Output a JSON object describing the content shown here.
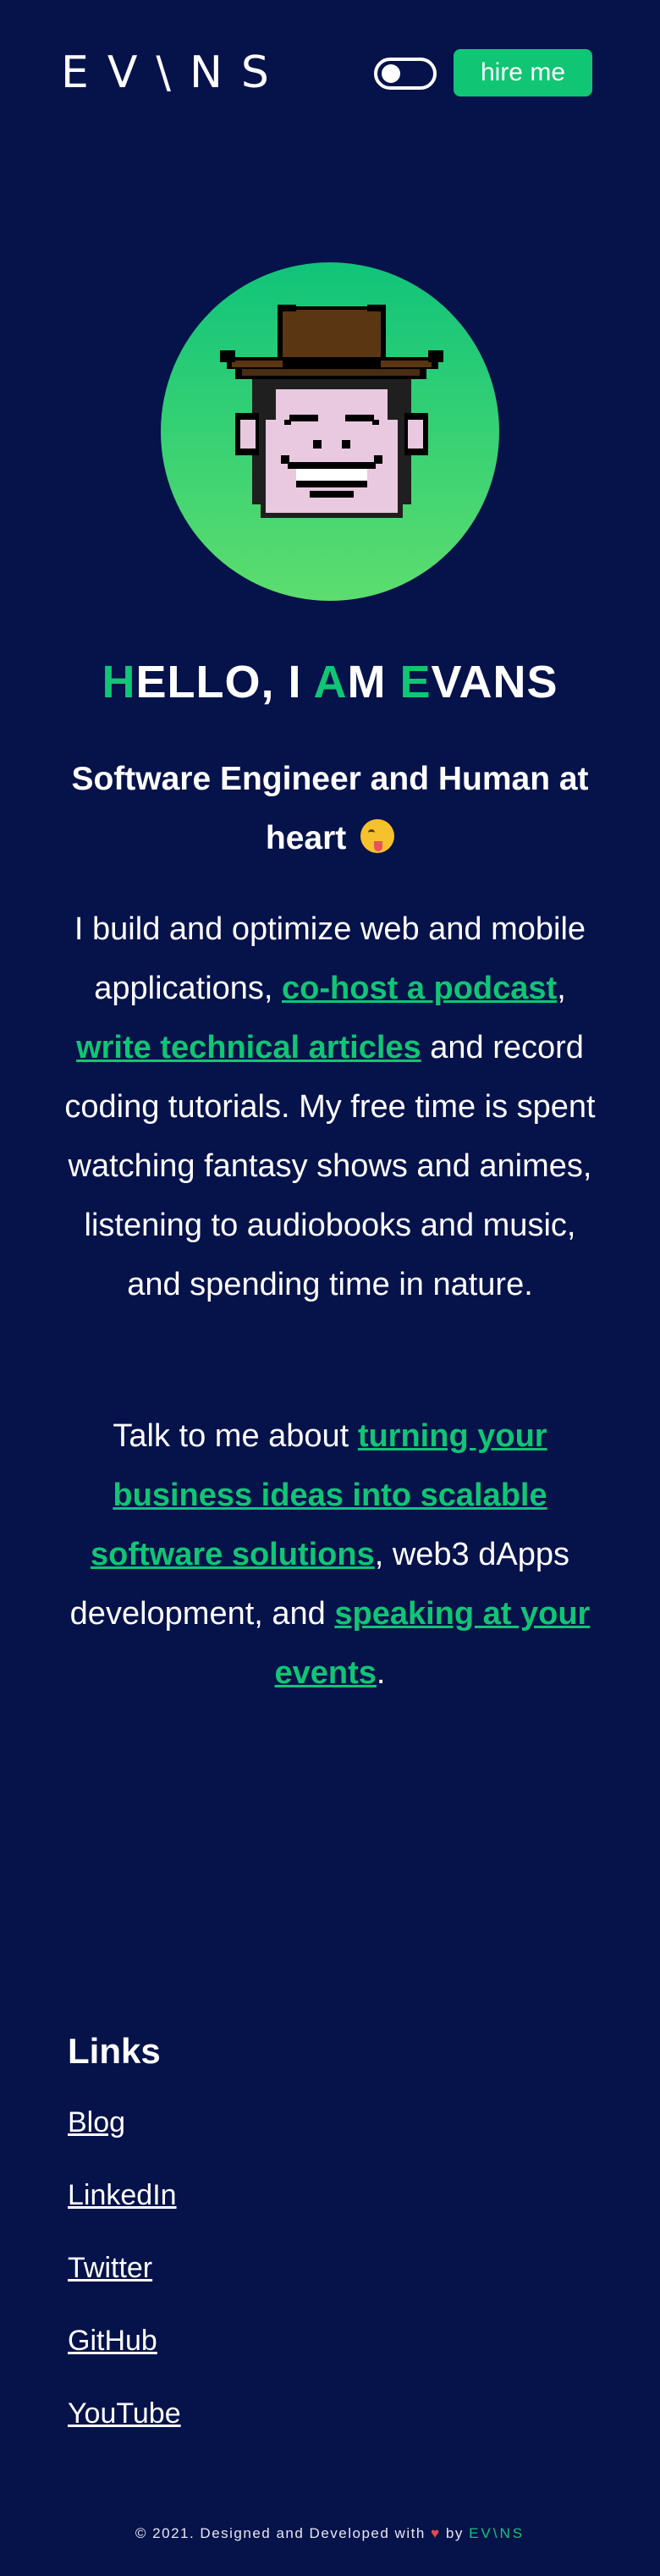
{
  "header": {
    "logo": "EV\\NS",
    "theme_toggle": "on",
    "hire_label": "hire me"
  },
  "avatar": {
    "icon": "pixel-monkey-cowboy-hat"
  },
  "hero": {
    "title_initials": [
      "H",
      "A",
      "E"
    ],
    "title_parts": [
      "ELLO, I ",
      "M ",
      "VANS"
    ],
    "subtitle": "Software Engineer and Human at heart",
    "subtitle_emoji": "zany-face"
  },
  "about": {
    "p1_text_1": "I build and optimize web and mobile applications, ",
    "p1_link_1": "co-host a podcast",
    "p1_text_2": ", ",
    "p1_link_2": "write technical articles",
    "p1_text_3": " and record coding tutorials. My free time is spent watching fantasy shows and animes, listening to audiobooks and music, and spending time in nature.",
    "p2_text_1": "Talk to me about ",
    "p2_link_1": "turning your business ideas into scalable software solutions",
    "p2_text_2": ", web3 dApps development, and ",
    "p2_link_2": "speaking at your events",
    "p2_text_3": "."
  },
  "links": {
    "title": "Links",
    "items": [
      "Blog",
      "LinkedIn",
      "Twitter",
      "GitHub",
      "YouTube"
    ]
  },
  "footer": {
    "text": "© 2021. Designed and Developed with",
    "heart": "♥",
    "by": "by",
    "brand": "EV\\NS"
  },
  "colors": {
    "background": "#06124a",
    "accent": "#10c574",
    "text": "#ffffff"
  }
}
